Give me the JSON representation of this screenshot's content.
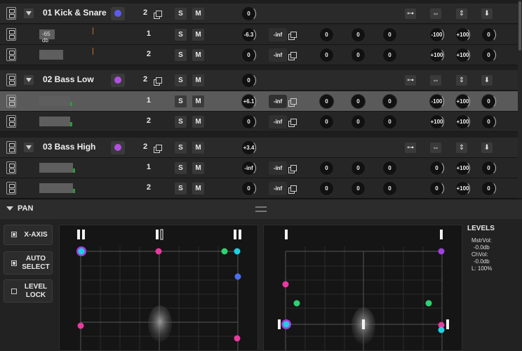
{
  "tracks": [
    {
      "kind": "group",
      "name": "01 Kick & Snare",
      "dot": "#5b5bf0",
      "ch": "2",
      "s": "S",
      "m": "M",
      "vol": "0",
      "icons": [
        "⊶",
        "⇔",
        "⇕",
        "⬇"
      ]
    },
    {
      "kind": "sub",
      "meter_text": "-65 db",
      "meterw": 22,
      "peak": 74,
      "peakc": "o",
      "ch": "1",
      "s": "S",
      "m": "M",
      "vol": "-6.3",
      "trim": "-inf",
      "k1": "0",
      "k2": "0",
      "k3": "0",
      "p1": "-100",
      "p2": "+100",
      "p3": "0"
    },
    {
      "kind": "sub",
      "meter_text": "",
      "meterw": 34,
      "peak": 74,
      "peakc": "o",
      "ch": "2",
      "s": "S",
      "m": "M",
      "vol": "0",
      "trim": "-inf",
      "k1": "0",
      "k2": "0",
      "k3": "0",
      "p1": "+100",
      "p2": "+100",
      "p3": "0"
    },
    {
      "kind": "group",
      "name": "02 Bass Low",
      "dot": "#b050e0",
      "ch": "2",
      "s": "S",
      "m": "M",
      "vol": "0",
      "icons": [
        "⊶",
        "⇔",
        "⇕",
        "⬇"
      ]
    },
    {
      "kind": "sub",
      "sel": true,
      "meter_text": "",
      "meterw": 44,
      "peak": 50,
      "peakc": "g",
      "ch": "1",
      "s": "S",
      "m": "M",
      "vol": "+6.1",
      "trim": "-inf",
      "k1": "0",
      "k2": "0",
      "k3": "0",
      "p1": "-100",
      "p2": "+100",
      "p3": "0"
    },
    {
      "kind": "sub",
      "meter_text": "",
      "meterw": 44,
      "peak": 50,
      "peakc": "g",
      "ch": "2",
      "s": "S",
      "m": "M",
      "vol": "0",
      "trim": "-inf",
      "k1": "0",
      "k2": "0",
      "k3": "0",
      "p1": "+100",
      "p2": "+100",
      "p3": "0"
    },
    {
      "kind": "group",
      "name": "03 Bass High",
      "dot": "#b050e0",
      "ch": "2",
      "s": "S",
      "m": "M",
      "vol": "+3.4",
      "icons": [
        "⊶",
        "⇔",
        "⇕",
        "⬇"
      ]
    },
    {
      "kind": "sub",
      "meter_text": "",
      "meterw": 48,
      "peak": 0,
      "peakc": "g",
      "ch": "1",
      "s": "S",
      "m": "M",
      "vol": "-inf",
      "trim": "-inf",
      "k1": "0",
      "k2": "0",
      "k3": "0",
      "p1": "0",
      "p2": "+100",
      "p3": "0"
    },
    {
      "kind": "sub",
      "meter_text": "",
      "meterw": 48,
      "peak": 50,
      "peakc": "g",
      "ch": "2",
      "s": "S",
      "m": "M",
      "vol": "0",
      "trim": "-inf",
      "k1": "0",
      "k2": "0",
      "k3": "0",
      "p1": "0",
      "p2": "+100",
      "p3": "0"
    }
  ],
  "pan": {
    "title": "PAN",
    "buttons": [
      {
        "label": "X-AXIS",
        "checked": true
      },
      {
        "label": "AUTO SELECT",
        "checked": true
      },
      {
        "label": "LEVEL LOCK",
        "checked": false
      }
    ]
  },
  "levels": {
    "title": "LEVELS",
    "lines": [
      "MstrVol:",
      "-0.0db",
      "ChVol:",
      "-0.0db",
      "L: 100%"
    ]
  },
  "colors": {
    "pink": "#e83aa0",
    "cyan": "#20d0e0",
    "green": "#2fd070",
    "blue": "#4a6ff0",
    "purple": "#a040e0"
  }
}
